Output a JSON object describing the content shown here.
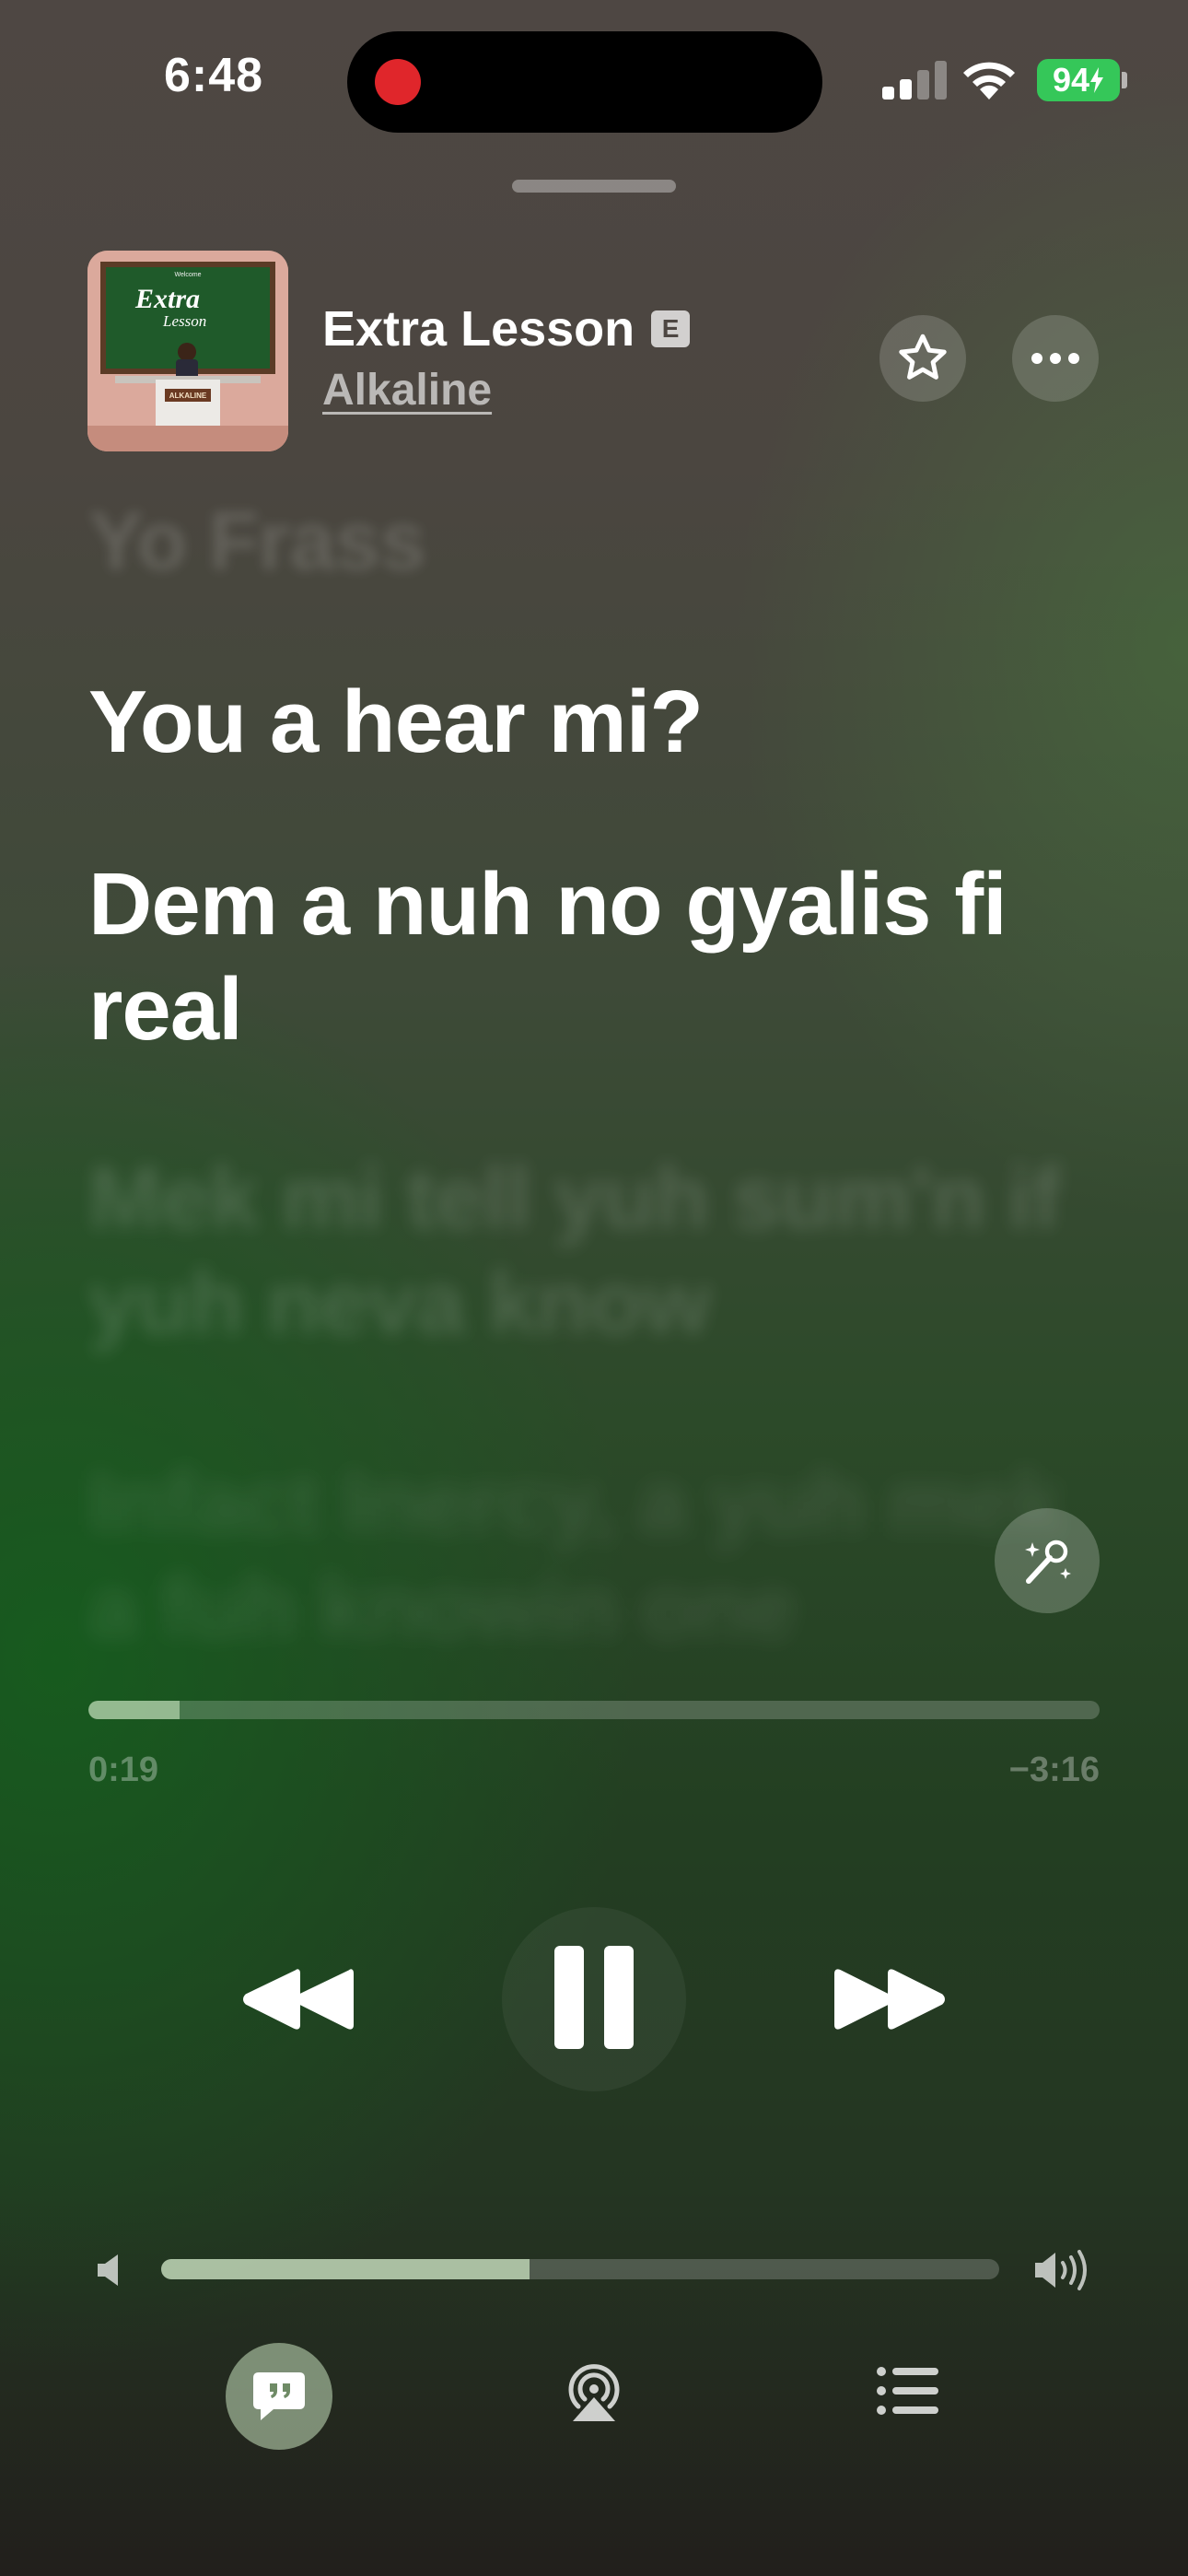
{
  "status_bar": {
    "time": "6:48",
    "battery": "94",
    "recording_color": "#e0262b",
    "battery_color": "#35c759"
  },
  "now_playing": {
    "title": "Extra Lesson",
    "explicit_badge": "E",
    "artist": "Alkaline",
    "artwork": {
      "label_welcome": "Welcome",
      "label_title_1": "Extra",
      "label_title_2": "Lesson",
      "label_desk": "ALKALINE"
    }
  },
  "lyrics": {
    "previous_line": "Yo Frass",
    "active_lines": [
      "You a hear mi?",
      "Dem a nuh no gyalis fi real"
    ],
    "next_line": "Mek mi tell yuh sum'n if yuh neva know",
    "upcoming_line": "Infact Inercy, a yuh mek a fuh knowin one"
  },
  "playback": {
    "elapsed": "0:19",
    "remaining": "−3:16",
    "progress_fraction": 0.09,
    "state": "playing"
  },
  "volume": {
    "level_fraction": 0.44
  },
  "icons": {
    "favorite": "star-icon",
    "more": "ellipsis-icon",
    "sing": "microphone-sparkle-icon",
    "previous": "backward-icon",
    "pause": "pause-icon",
    "next": "forward-icon",
    "volume_low": "speaker-low-icon",
    "volume_high": "speaker-high-icon",
    "lyrics": "lyrics-quote-icon",
    "airplay": "airplay-icon",
    "queue": "list-icon"
  }
}
